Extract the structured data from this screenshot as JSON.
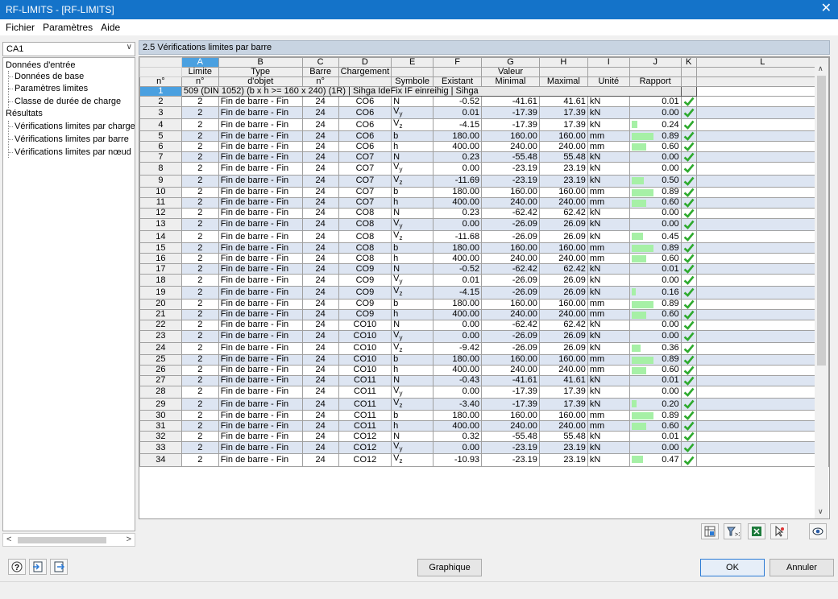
{
  "window": {
    "title": "RF-LIMITS - [RF-LIMITS]",
    "close": "✕"
  },
  "menu": [
    "Fichier",
    "Paramètres",
    "Aide"
  ],
  "case_select": {
    "value": "CA1",
    "arrow": "∨"
  },
  "tree": {
    "input_group": "Données d'entrée",
    "input_items": [
      "Données de base",
      "Paramètres limites",
      "Classe de durée de charge"
    ],
    "results_group": "Résultats",
    "results_items": [
      "Vérifications limites par charger",
      "Vérifications limites par barre",
      "Vérifications limites par nœud"
    ]
  },
  "panel": {
    "title": "2.5 Vérifications limites par barre"
  },
  "grid": {
    "col_letters": [
      "A",
      "B",
      "C",
      "D",
      "E",
      "F",
      "G",
      "H",
      "I",
      "J",
      "K",
      "L"
    ],
    "header1": {
      "A": "Limite",
      "B": "Type",
      "C": "Barre",
      "D": "Chargement",
      "G": "Valeur"
    },
    "header2": {
      "rn": "n°",
      "A": "n°",
      "B": "d'objet",
      "C": "n°",
      "E": "Symbole",
      "F": "Existant",
      "G": "Minimal",
      "H": "Maximal",
      "I": "Unité",
      "J": "Rapport"
    },
    "group_row": {
      "num": "1",
      "text": "509 (DIN 1052) (b x h >= 160 x 240) (1R) | Sihga IdeFix IF einreihig | Sihga"
    },
    "rows": [
      [
        "2",
        "2",
        "Fin de barre - Fin",
        "24",
        "CO6",
        "N",
        "-0.52",
        "-41.61",
        "41.61",
        "kN",
        "0.01"
      ],
      [
        "3",
        "2",
        "Fin de barre - Fin",
        "24",
        "CO6",
        "Vy",
        "0.01",
        "-17.39",
        "17.39",
        "kN",
        "0.00"
      ],
      [
        "4",
        "2",
        "Fin de barre - Fin",
        "24",
        "CO6",
        "Vz",
        "-4.15",
        "-17.39",
        "17.39",
        "kN",
        "0.24"
      ],
      [
        "5",
        "2",
        "Fin de barre - Fin",
        "24",
        "CO6",
        "b",
        "180.00",
        "160.00",
        "160.00",
        "mm",
        "0.89"
      ],
      [
        "6",
        "2",
        "Fin de barre - Fin",
        "24",
        "CO6",
        "h",
        "400.00",
        "240.00",
        "240.00",
        "mm",
        "0.60"
      ],
      [
        "7",
        "2",
        "Fin de barre - Fin",
        "24",
        "CO7",
        "N",
        "0.23",
        "-55.48",
        "55.48",
        "kN",
        "0.00"
      ],
      [
        "8",
        "2",
        "Fin de barre - Fin",
        "24",
        "CO7",
        "Vy",
        "0.00",
        "-23.19",
        "23.19",
        "kN",
        "0.00"
      ],
      [
        "9",
        "2",
        "Fin de barre - Fin",
        "24",
        "CO7",
        "Vz",
        "-11.69",
        "-23.19",
        "23.19",
        "kN",
        "0.50"
      ],
      [
        "10",
        "2",
        "Fin de barre - Fin",
        "24",
        "CO7",
        "b",
        "180.00",
        "160.00",
        "160.00",
        "mm",
        "0.89"
      ],
      [
        "11",
        "2",
        "Fin de barre - Fin",
        "24",
        "CO7",
        "h",
        "400.00",
        "240.00",
        "240.00",
        "mm",
        "0.60"
      ],
      [
        "12",
        "2",
        "Fin de barre - Fin",
        "24",
        "CO8",
        "N",
        "0.23",
        "-62.42",
        "62.42",
        "kN",
        "0.00"
      ],
      [
        "13",
        "2",
        "Fin de barre - Fin",
        "24",
        "CO8",
        "Vy",
        "0.00",
        "-26.09",
        "26.09",
        "kN",
        "0.00"
      ],
      [
        "14",
        "2",
        "Fin de barre - Fin",
        "24",
        "CO8",
        "Vz",
        "-11.68",
        "-26.09",
        "26.09",
        "kN",
        "0.45"
      ],
      [
        "15",
        "2",
        "Fin de barre - Fin",
        "24",
        "CO8",
        "b",
        "180.00",
        "160.00",
        "160.00",
        "mm",
        "0.89"
      ],
      [
        "16",
        "2",
        "Fin de barre - Fin",
        "24",
        "CO8",
        "h",
        "400.00",
        "240.00",
        "240.00",
        "mm",
        "0.60"
      ],
      [
        "17",
        "2",
        "Fin de barre - Fin",
        "24",
        "CO9",
        "N",
        "-0.52",
        "-62.42",
        "62.42",
        "kN",
        "0.01"
      ],
      [
        "18",
        "2",
        "Fin de barre - Fin",
        "24",
        "CO9",
        "Vy",
        "0.01",
        "-26.09",
        "26.09",
        "kN",
        "0.00"
      ],
      [
        "19",
        "2",
        "Fin de barre - Fin",
        "24",
        "CO9",
        "Vz",
        "-4.15",
        "-26.09",
        "26.09",
        "kN",
        "0.16"
      ],
      [
        "20",
        "2",
        "Fin de barre - Fin",
        "24",
        "CO9",
        "b",
        "180.00",
        "160.00",
        "160.00",
        "mm",
        "0.89"
      ],
      [
        "21",
        "2",
        "Fin de barre - Fin",
        "24",
        "CO9",
        "h",
        "400.00",
        "240.00",
        "240.00",
        "mm",
        "0.60"
      ],
      [
        "22",
        "2",
        "Fin de barre - Fin",
        "24",
        "CO10",
        "N",
        "0.00",
        "-62.42",
        "62.42",
        "kN",
        "0.00"
      ],
      [
        "23",
        "2",
        "Fin de barre - Fin",
        "24",
        "CO10",
        "Vy",
        "0.00",
        "-26.09",
        "26.09",
        "kN",
        "0.00"
      ],
      [
        "24",
        "2",
        "Fin de barre - Fin",
        "24",
        "CO10",
        "Vz",
        "-9.42",
        "-26.09",
        "26.09",
        "kN",
        "0.36"
      ],
      [
        "25",
        "2",
        "Fin de barre - Fin",
        "24",
        "CO10",
        "b",
        "180.00",
        "160.00",
        "160.00",
        "mm",
        "0.89"
      ],
      [
        "26",
        "2",
        "Fin de barre - Fin",
        "24",
        "CO10",
        "h",
        "400.00",
        "240.00",
        "240.00",
        "mm",
        "0.60"
      ],
      [
        "27",
        "2",
        "Fin de barre - Fin",
        "24",
        "CO11",
        "N",
        "-0.43",
        "-41.61",
        "41.61",
        "kN",
        "0.01"
      ],
      [
        "28",
        "2",
        "Fin de barre - Fin",
        "24",
        "CO11",
        "Vy",
        "0.00",
        "-17.39",
        "17.39",
        "kN",
        "0.00"
      ],
      [
        "29",
        "2",
        "Fin de barre - Fin",
        "24",
        "CO11",
        "Vz",
        "-3.40",
        "-17.39",
        "17.39",
        "kN",
        "0.20"
      ],
      [
        "30",
        "2",
        "Fin de barre - Fin",
        "24",
        "CO11",
        "b",
        "180.00",
        "160.00",
        "160.00",
        "mm",
        "0.89"
      ],
      [
        "31",
        "2",
        "Fin de barre - Fin",
        "24",
        "CO11",
        "h",
        "400.00",
        "240.00",
        "240.00",
        "mm",
        "0.60"
      ],
      [
        "32",
        "2",
        "Fin de barre - Fin",
        "24",
        "CO12",
        "N",
        "0.32",
        "-55.48",
        "55.48",
        "kN",
        "0.01"
      ],
      [
        "33",
        "2",
        "Fin de barre - Fin",
        "24",
        "CO12",
        "Vy",
        "0.00",
        "-23.19",
        "23.19",
        "kN",
        "0.00"
      ],
      [
        "34",
        "2",
        "Fin de barre - Fin",
        "24",
        "CO12",
        "Vz",
        "-10.93",
        "-23.19",
        "23.19",
        "kN",
        "0.47"
      ]
    ]
  },
  "buttons": {
    "graphique": "Graphique",
    "ok": "OK",
    "annuler": "Annuler"
  },
  "colors": {
    "titlebar": "#1473c9",
    "selected_header": "#4aa0e0",
    "row_alt": "#dde5f2",
    "ratio_bar": "#a6f0a6",
    "check": "#2eaa2e"
  }
}
